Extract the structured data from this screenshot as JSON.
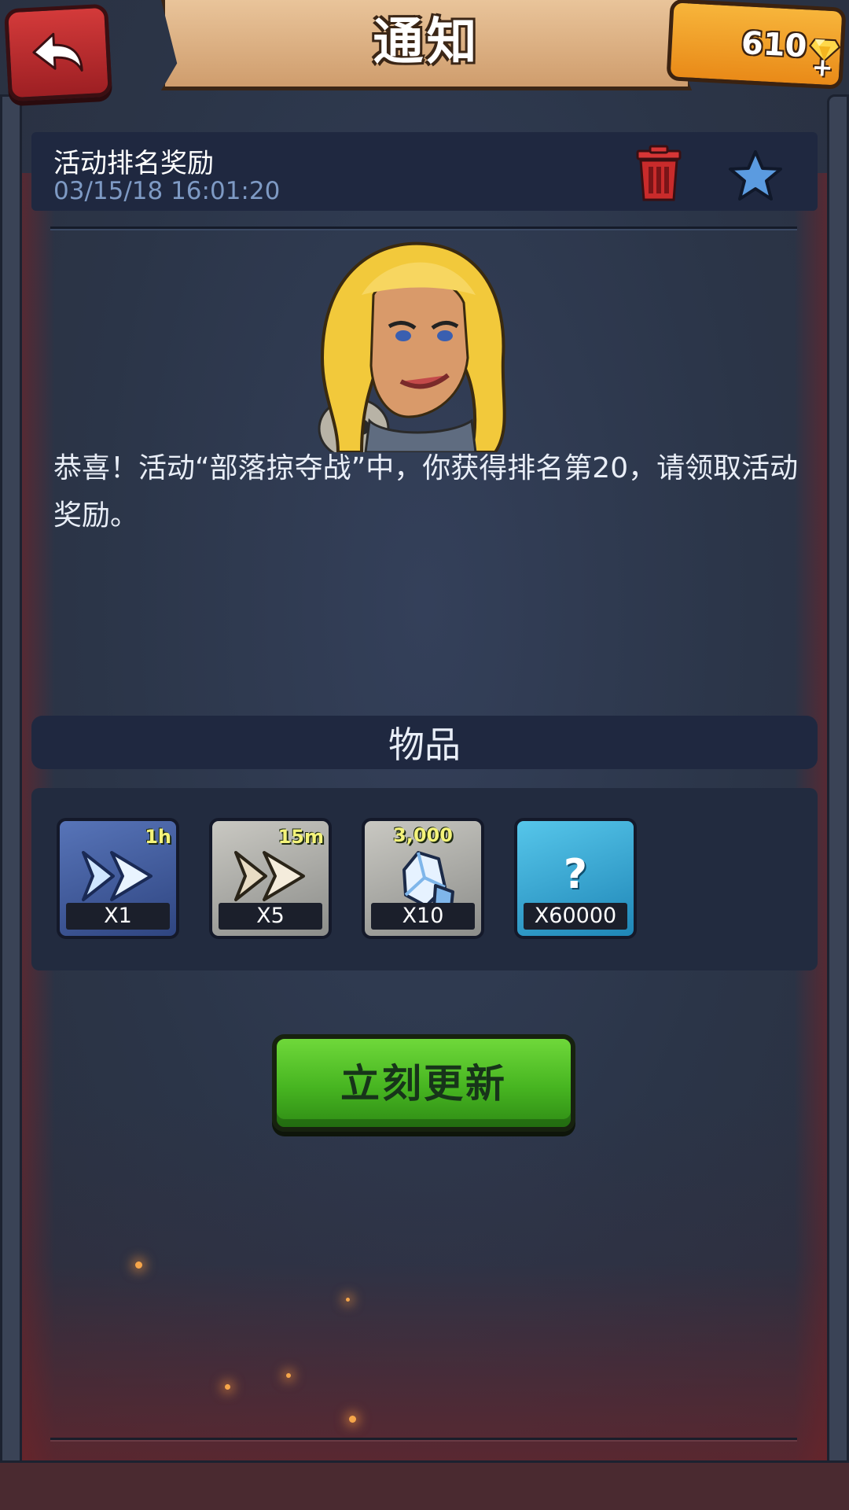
{
  "header": {
    "title": "通知",
    "gem_count": "610"
  },
  "mail": {
    "subject": "活动排名奖励",
    "date": "03/15/18 16:01:20",
    "body": "恭喜！活动“部落掠夺战”中，你获得排名第20，请领取活动奖励。"
  },
  "items": {
    "title": "物品",
    "list": [
      {
        "icon": "speedup-arrows-icon",
        "tag": "1h",
        "qty": "X1"
      },
      {
        "icon": "speedup-arrows-icon",
        "tag": "15m",
        "qty": "X5"
      },
      {
        "icon": "crystal-icon",
        "tag": "3,000",
        "qty": "X10"
      },
      {
        "icon": "question-mark-icon",
        "tag": "?",
        "qty": "X60000"
      }
    ]
  },
  "actions": {
    "claim_label": "立刻更新"
  },
  "colors": {
    "claim_button": "#47b521",
    "back_button": "#c62f33",
    "gem_counter": "#f1a02b",
    "date_text": "#7e9ac4"
  }
}
